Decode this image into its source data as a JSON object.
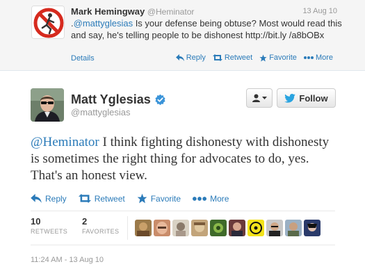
{
  "parent_tweet": {
    "name": "Mark Hemingway",
    "handle": "@Heminator",
    "date": "13 Aug 10",
    "text_prefix": ".",
    "mention": "@mattyglesias",
    "text_rest": " Is your defense being obtuse? Most would read this and say, he's telling people to be dishonest http://bit.ly /a8bOBx",
    "details_label": "Details",
    "actions": {
      "reply": "Reply",
      "retweet": "Retweet",
      "favorite": "Favorite",
      "more": "More"
    },
    "avatar_icon": "no-running-man-icon"
  },
  "main_tweet": {
    "name": "Matt Yglesias",
    "handle": "@mattyglesias",
    "verified_icon": "verified-badge-icon",
    "follow_label": "Follow",
    "mention": "@Heminator",
    "text_rest": " I think fighting dishonesty with dishonesty is sometimes the right thing for advocates to do, yes. That's an honest view.",
    "actions": {
      "reply": "Reply",
      "retweet": "Retweet",
      "favorite": "Favorite",
      "more": "More"
    },
    "retweets_count": "10",
    "retweets_label": "RETWEETS",
    "favorites_count": "2",
    "favorites_label": "FAVORITES",
    "timestamp": "11:24 AM - 13 Aug 10"
  },
  "colors": {
    "link": "#2b7bb9",
    "text": "#333333",
    "muted": "#999999",
    "parent_bg": "#f5f5f5",
    "verified": "#3b94d9"
  }
}
